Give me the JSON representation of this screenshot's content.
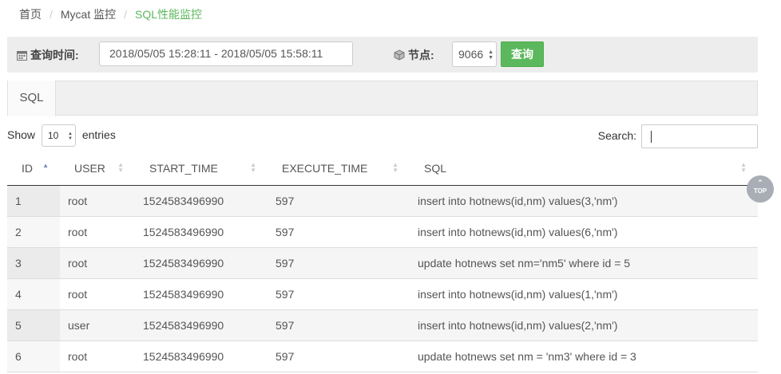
{
  "breadcrumb": {
    "home": "首页",
    "parent": "Mycat 监控",
    "current": "SQL性能监控"
  },
  "query": {
    "time_label": "查询时间:",
    "time_value": "2018/05/05 15:28:11 - 2018/05/05 15:58:11",
    "node_label": "节点:",
    "node_value": "9066",
    "submit_label": "查询",
    "icons": {
      "time": "calendar-icon",
      "node": "cube-icon"
    }
  },
  "tabs": [
    {
      "label": "SQL",
      "active": true
    }
  ],
  "table_controls": {
    "show_label": "Show",
    "page_length": "10",
    "entries_label": "entries",
    "search_label": "Search:",
    "search_value": ""
  },
  "table": {
    "columns": [
      "ID",
      "USER",
      "START_TIME",
      "EXECUTE_TIME",
      "SQL"
    ],
    "sorted_column": "ID",
    "rows": [
      [
        "1",
        "root",
        "1524583496990",
        "597",
        "insert into hotnews(id,nm) values(3,'nm')"
      ],
      [
        "2",
        "root",
        "1524583496990",
        "597",
        "insert into hotnews(id,nm) values(6,'nm')"
      ],
      [
        "3",
        "root",
        "1524583496990",
        "597",
        "update hotnews set nm='nm5' where id = 5"
      ],
      [
        "4",
        "root",
        "1524583496990",
        "597",
        "insert into hotnews(id,nm) values(1,'nm')"
      ],
      [
        "5",
        "user",
        "1524583496990",
        "597",
        "insert into hotnews(id,nm) values(2,'nm')"
      ],
      [
        "6",
        "root",
        "1524583496990",
        "597",
        "update hotnews set nm = 'nm3' where id = 3"
      ]
    ]
  },
  "back_to_top": {
    "label": "TOP"
  },
  "colors": {
    "accent": "#5cb85c",
    "breadcrumb_active": "#5cb85c",
    "sort_active": "#7b88b6"
  }
}
